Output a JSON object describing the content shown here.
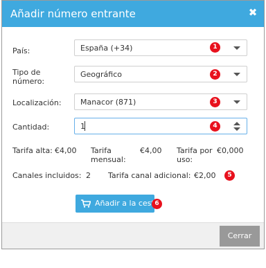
{
  "dialog": {
    "title": "Añadir número entrante",
    "close_icon": "close-icon"
  },
  "form": {
    "country_label": "País:",
    "country_value": "España (+34)",
    "number_type_label_1": "Tipo de",
    "number_type_label_2": "número:",
    "number_type_value": "Geográfico",
    "location_label": "Localización:",
    "location_value": "Manacor (871)",
    "quantity_label": "Cantidad:",
    "quantity_value": "1"
  },
  "pricing": {
    "tarifa_alta_label": "Tarifa alta:",
    "tarifa_alta_value": "€4,00",
    "tarifa_mensual_label_1": "Tarifa",
    "tarifa_mensual_label_2": "mensual:",
    "tarifa_mensual_value": "€4,00",
    "tarifa_uso_label_1": "Tarifa por",
    "tarifa_uso_label_2": "uso:",
    "tarifa_uso_value": "€0,000",
    "canales_label": "Canales incluidos:",
    "canales_value": "2",
    "canal_adicional_label": "Tarifa canal adicional:",
    "canal_adicional_value": "€2,00"
  },
  "actions": {
    "add_to_cart_label": "Añadir a la cesta",
    "close_label": "Cerrar"
  },
  "badges": [
    "1",
    "2",
    "3",
    "4",
    "5",
    "6"
  ],
  "colors": {
    "header": "#3fa9df",
    "badge": "#e8111d",
    "footer_button": "#999999"
  }
}
